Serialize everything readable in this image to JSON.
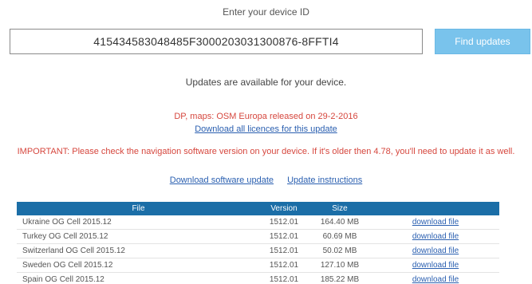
{
  "device": {
    "label": "Enter your device ID",
    "input_value": "415434583048485F3000203031300876-8FFTI4",
    "find_button": "Find updates"
  },
  "status": {
    "available": "Updates are available for your device.",
    "release": "DP, maps: OSM Europa released on 29-2-2016",
    "license_link": "Download all licences for this update",
    "important": "IMPORTANT: Please check the navigation software version on your device. If it's older then 4.78, you'll need to update it as well.",
    "software_link": "Download software update",
    "instructions_link": "Update instructions"
  },
  "table": {
    "headers": {
      "file": "File",
      "version": "Version",
      "size": "Size",
      "download": ""
    },
    "rows": [
      {
        "file": "Ukraine OG Cell 2015.12",
        "version": "1512.01",
        "size": "164.40 MB",
        "link": "download file"
      },
      {
        "file": "Turkey OG Cell 2015.12",
        "version": "1512.01",
        "size": "60.69 MB",
        "link": "download file"
      },
      {
        "file": "Switzerland OG Cell 2015.12",
        "version": "1512.01",
        "size": "50.02 MB",
        "link": "download file"
      },
      {
        "file": "Sweden OG Cell 2015.12",
        "version": "1512.01",
        "size": "127.10 MB",
        "link": "download file"
      },
      {
        "file": "Spain OG Cell 2015.12",
        "version": "1512.01",
        "size": "185.22 MB",
        "link": "download file"
      }
    ]
  }
}
